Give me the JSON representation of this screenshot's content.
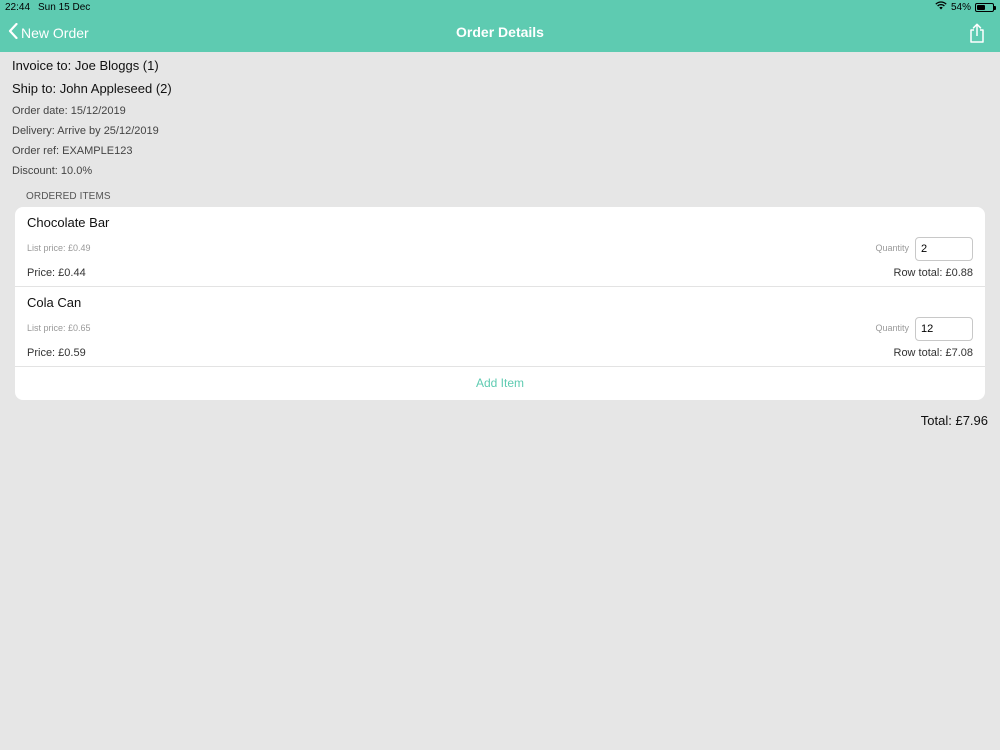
{
  "status": {
    "time": "22:44",
    "date": "Sun 15 Dec",
    "battery": "54%",
    "battery_level": 0.54
  },
  "nav": {
    "back_label": "New Order",
    "title": "Order Details",
    "share_icon": "share-icon"
  },
  "order": {
    "invoice_to": "Invoice to: Joe Bloggs (1)",
    "ship_to": "Ship to: John Appleseed (2)",
    "order_date": "Order date: 15/12/2019",
    "delivery": "Delivery: Arrive by 25/12/2019",
    "order_ref": "Order ref: EXAMPLE123",
    "discount": "Discount: 10.0%"
  },
  "items_section": {
    "header": "ORDERED ITEMS",
    "add_item_label": "Add Item",
    "quantity_label": "Quantity",
    "items": [
      {
        "name": "Chocolate Bar",
        "list_price": "List price: £0.49",
        "quantity": "2",
        "price": "Price: £0.44",
        "row_total": "Row total: £0.88"
      },
      {
        "name": "Cola Can",
        "list_price": "List price: £0.65",
        "quantity": "12",
        "price": "Price: £0.59",
        "row_total": "Row total: £7.08"
      }
    ]
  },
  "total": "Total: £7.96",
  "colors": {
    "accent": "#5ecbb1",
    "background": "#e6e6e6"
  }
}
